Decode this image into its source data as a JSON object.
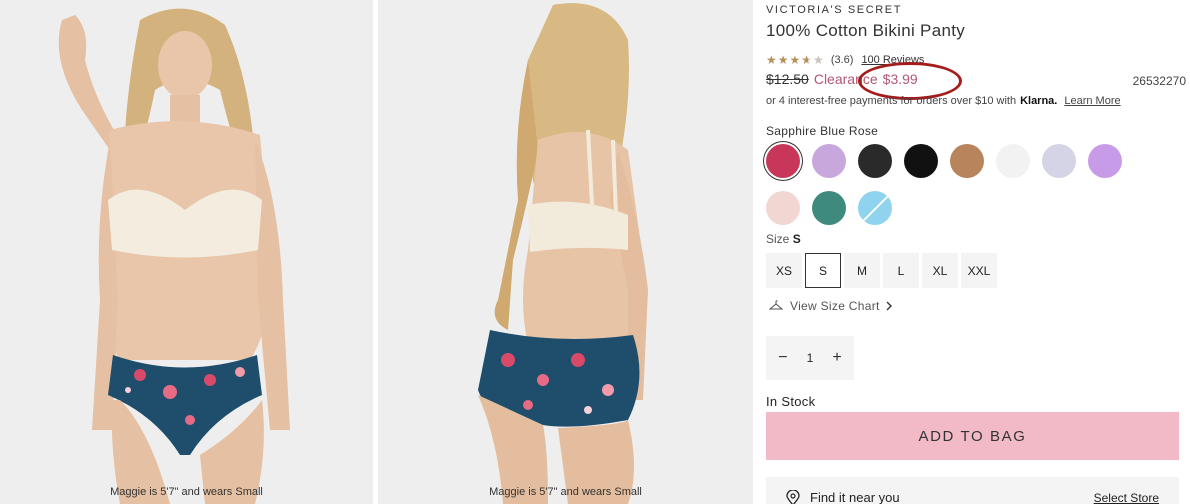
{
  "gallery": {
    "image1_caption": "Maggie is 5'7\" and wears Small",
    "image2_caption": "Maggie is 5'7\" and wears Small"
  },
  "product": {
    "brand": "VICTORIA'S SECRET",
    "title": "100% Cotton Bikini Panty",
    "rating": {
      "value_text": "(3.6)",
      "reviews_link": "100 Reviews",
      "stars": 3.6
    },
    "price": {
      "original": "$12.50",
      "clearance_label": "Clearance",
      "sale": "$3.99"
    },
    "sku": "26532270",
    "klarna": {
      "text": "or 4 interest-free payments for orders over $10 with",
      "logo": "Klarna.",
      "link": "Learn More"
    },
    "color": {
      "selected_name": "Sapphire Blue Rose",
      "swatches": [
        {
          "name": "sapphire-blue-rose",
          "color": "#c8375a",
          "selected": true
        },
        {
          "name": "lilac",
          "color": "#c8a7dc"
        },
        {
          "name": "black-script-print",
          "color": "#2a2a2a"
        },
        {
          "name": "black",
          "color": "#111111"
        },
        {
          "name": "leopard",
          "color": "#b8845c"
        },
        {
          "name": "white",
          "color": "#f2f2f2"
        },
        {
          "name": "lavender-heather",
          "color": "#d4d4e6"
        },
        {
          "name": "purple",
          "color": "#c89be8"
        },
        {
          "name": "blush-stripe",
          "color": "#f2d6d2"
        },
        {
          "name": "teal",
          "color": "#3f8a7e"
        },
        {
          "name": "sky-blue",
          "color": "#8fd3ef",
          "unavailable": true
        }
      ]
    },
    "size": {
      "label": "Size",
      "selected": "S",
      "options": [
        "XS",
        "S",
        "M",
        "L",
        "XL",
        "XXL"
      ]
    },
    "size_chart_link": "View Size Chart",
    "quantity": {
      "value": "1",
      "minus": "−",
      "plus": "+"
    },
    "stock_status": "In Stock",
    "add_to_bag": "ADD TO BAG",
    "find_store": {
      "label": "Find it near you",
      "link": "Select Store"
    }
  }
}
